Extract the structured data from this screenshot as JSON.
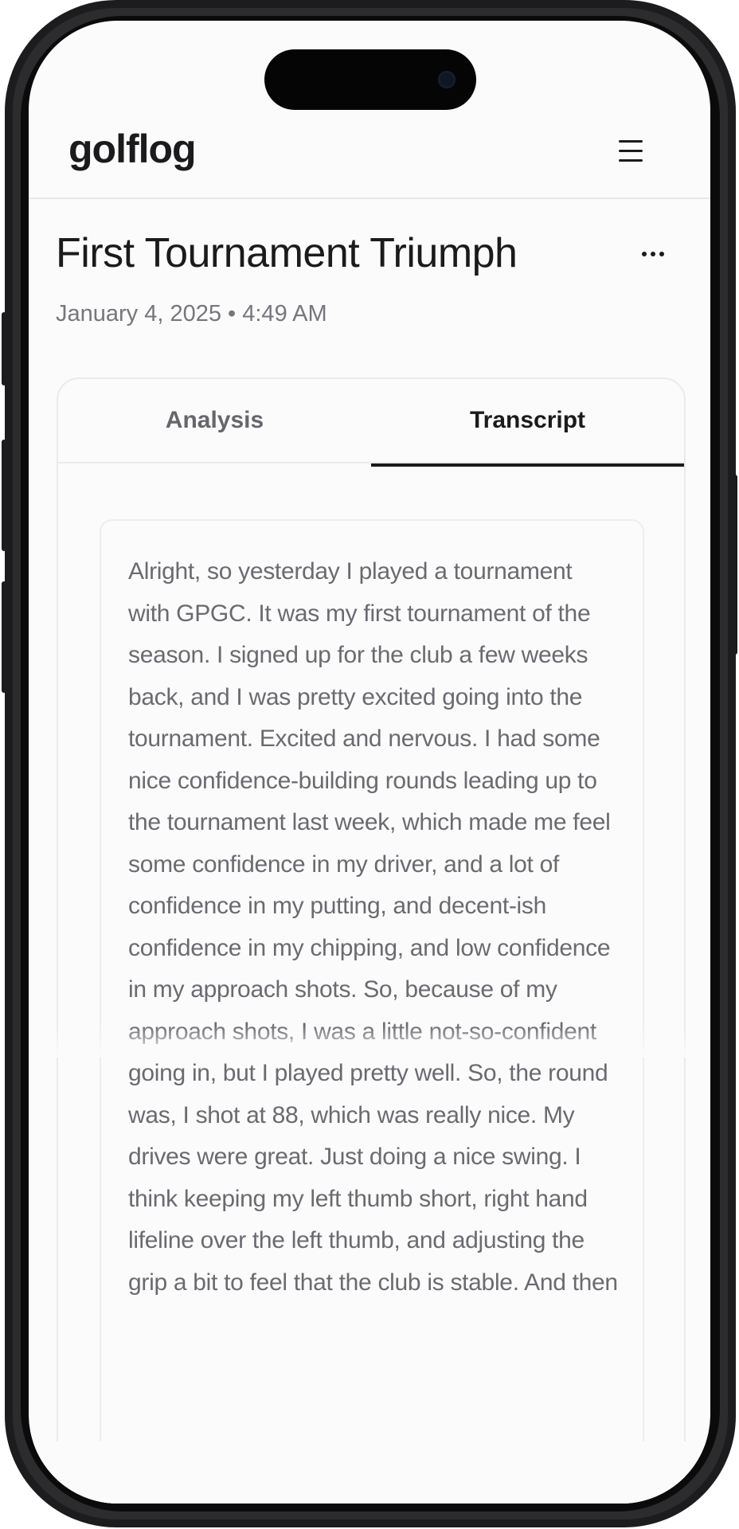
{
  "app": {
    "logo": "golflog",
    "menu_icon": "hamburger-menu-icon"
  },
  "entry": {
    "title": "First Tournament Triumph",
    "timestamp": "January 4, 2025 • 4:49 AM",
    "more_icon": "more-horizontal-icon"
  },
  "tabs": [
    {
      "label": "Analysis",
      "active": false
    },
    {
      "label": "Transcript",
      "active": true
    }
  ],
  "transcript": {
    "text": "Alright, so yesterday I played a tournament with GPGC. It was my first tournament of the season. I signed up for the club a few weeks back, and I was pretty excited going into the tournament. Excited and nervous. I had some nice confidence-building rounds leading up to the tournament last week, which made me feel some confidence in my driver, and a lot of confidence in my putting, and decent-ish confidence in my chipping, and low confidence in my approach shots. So, because of my approach shots, I was a little not-so-confident going in, but I played pretty well. So, the round was, I shot at 88, which was really nice. My drives were great. Just doing a nice swing. I think keeping my left thumb short, right hand lifeline over the left thumb, and adjusting the grip a bit to feel that the club is stable. And then"
  },
  "colors": {
    "screen_bg": "#fcfbfb",
    "text_primary": "#1b1b1d",
    "text_secondary": "#76767c",
    "border": "#ece9e9"
  }
}
